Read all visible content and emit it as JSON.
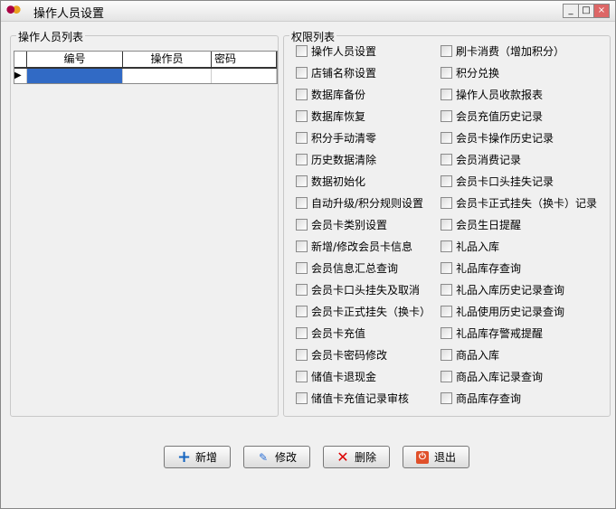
{
  "window": {
    "title": "操作人员设置"
  },
  "operator_list": {
    "legend": "操作人员列表",
    "columns": [
      "编号",
      "操作员",
      "密码"
    ]
  },
  "permissions": {
    "legend": "权限列表",
    "left": [
      "操作人员设置",
      "店铺名称设置",
      "数据库备份",
      "数据库恢复",
      "积分手动清零",
      "历史数据清除",
      "数据初始化",
      "自动升级/积分规则设置",
      "会员卡类别设置",
      "新增/修改会员卡信息",
      "会员信息汇总查询",
      "会员卡口头挂失及取消",
      "会员卡正式挂失（换卡）",
      "会员卡充值",
      "会员卡密码修改",
      "储值卡退现金",
      "储值卡充值记录审核"
    ],
    "right": [
      "刷卡消费（增加积分）",
      "积分兑换",
      "操作人员收款报表",
      "会员充值历史记录",
      "会员卡操作历史记录",
      "会员消费记录",
      "会员卡口头挂失记录",
      "会员卡正式挂失（换卡）记录",
      "会员生日提醒",
      "礼品入库",
      "礼品库存查询",
      "礼品入库历史记录查询",
      "礼品使用历史记录查询",
      "礼品库存警戒提醒",
      "商品入库",
      "商品入库记录查询",
      "商品库存查询"
    ]
  },
  "buttons": {
    "add": "新增",
    "edit": "修改",
    "delete": "删除",
    "exit": "退出"
  }
}
